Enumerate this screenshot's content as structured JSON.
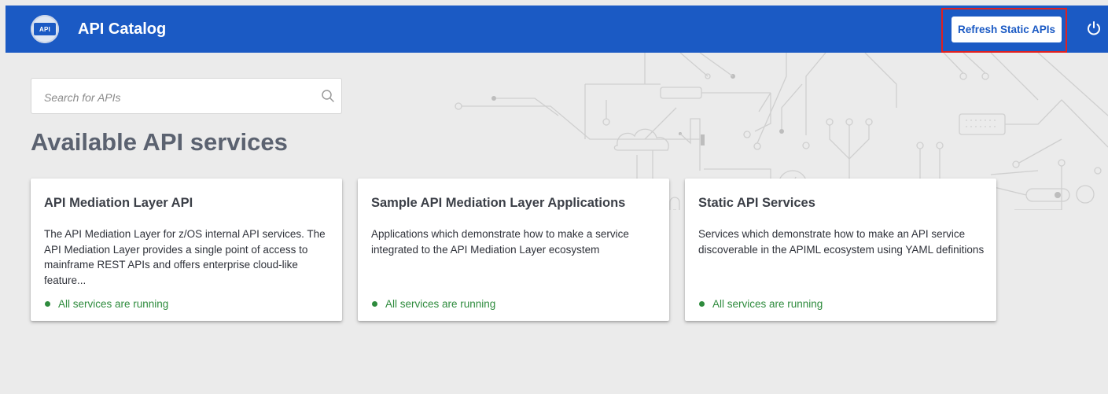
{
  "header": {
    "logo_text": "API",
    "title": "API Catalog",
    "refresh_label": "Refresh Static APIs",
    "accent": "#1b5ac4"
  },
  "search": {
    "placeholder": "Search for APIs",
    "value": ""
  },
  "page_title": "Available API services",
  "tiles": [
    {
      "title": "API Mediation Layer API",
      "description": "The API Mediation Layer for z/OS internal API services. The API Mediation Layer provides a single point of access to mainframe REST APIs and offers enterprise cloud-like feature...",
      "status": "All services are running"
    },
    {
      "title": "Sample API Mediation Layer Applications",
      "description": "Applications which demonstrate how to make a service integrated to the API Mediation Layer ecosystem",
      "status": "All services are running"
    },
    {
      "title": "Static API Services",
      "description": "Services which demonstrate how to make an API service discoverable in the APIML ecosystem using YAML definitions",
      "status": "All services are running"
    }
  ],
  "colors": {
    "status_ok": "#2e8b3d",
    "highlight": "#e02020"
  }
}
